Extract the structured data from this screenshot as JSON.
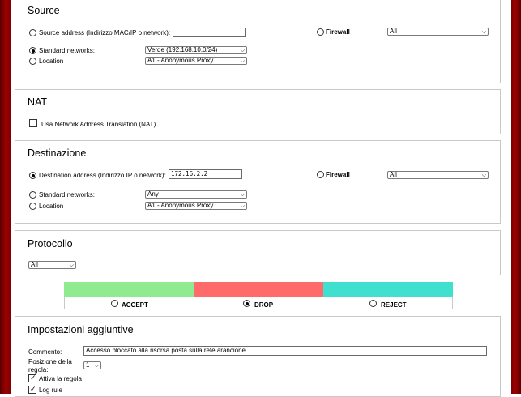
{
  "colors": {
    "frame": "#a10000",
    "accept": "#90ea90",
    "drop": "#ff6b6b",
    "reject": "#40e0d0"
  },
  "source": {
    "title": "Source",
    "address_label": "Source address (Indirizzo MAC/IP o network):",
    "address_value": "",
    "firewall_label": "Firewall",
    "firewall_value": "All",
    "standard_networks_label": "Standard networks:",
    "standard_networks_value": "Verde (192.168.10.0/24)",
    "location_label": "Location",
    "location_value": "A1 - Anonymous Proxy"
  },
  "nat": {
    "title": "NAT",
    "checkbox_label": "Usa Network Address Translation (NAT)"
  },
  "destinazione": {
    "title": "Destinazione",
    "address_label": "Destination address (Indirizzo IP o network):",
    "address_value": "172.16.2.2",
    "firewall_label": "Firewall",
    "firewall_value": "All",
    "standard_networks_label": "Standard networks:",
    "standard_networks_value": "Any",
    "location_label": "Location",
    "location_value": "A1 - Anonymous Proxy"
  },
  "protocollo": {
    "title": "Protocollo",
    "value": "All"
  },
  "actions": {
    "accept": "ACCEPT",
    "drop": "DROP",
    "reject": "REJECT"
  },
  "impostazioni": {
    "title": "Impostazioni aggiuntive",
    "commento_label": "Commento:",
    "commento_value": "Accesso bloccato alla risorsa posta sulla rete arancione",
    "posizione_label_1": "Posizione della",
    "posizione_label_2": "regola:",
    "posizione_value": "1",
    "attiva_label": "Attiva la regola",
    "log_label": "Log rule"
  }
}
